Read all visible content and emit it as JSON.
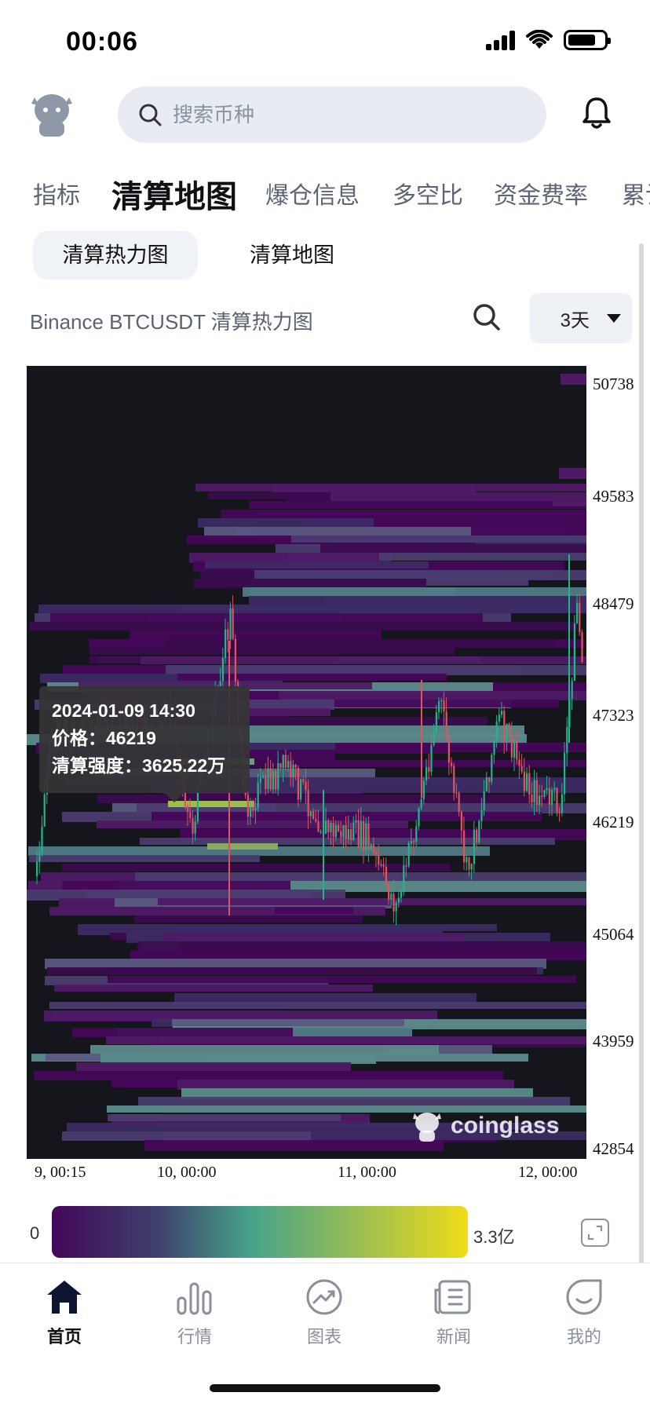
{
  "status_bar": {
    "time": "00:06"
  },
  "header": {
    "search_placeholder": "搜索币种"
  },
  "top_tabs": [
    {
      "label": "指标",
      "active": false
    },
    {
      "label": "清算地图",
      "active": true
    },
    {
      "label": "爆仓信息",
      "active": false
    },
    {
      "label": "多空比",
      "active": false
    },
    {
      "label": "资金费率",
      "active": false
    },
    {
      "label": "累计",
      "active": false
    }
  ],
  "sub_tabs": [
    {
      "label": "清算热力图",
      "active": true
    },
    {
      "label": "清算地图",
      "active": false
    }
  ],
  "chart_header": {
    "title": "Binance BTCUSDT 清算热力图",
    "range_value": "3天"
  },
  "chart_data": {
    "type": "heatmap",
    "y_ticks": [
      "50738",
      "49583",
      "48479",
      "47323",
      "46219",
      "45064",
      "43959",
      "42854"
    ],
    "x_ticks": [
      "9, 00:15",
      "10, 00:00",
      "11, 00:00",
      "12, 00:00"
    ],
    "ylim": [
      42854,
      50738
    ],
    "tooltip": {
      "time": "2024-01-09 14:30",
      "price_label": "价格：",
      "price": "46219",
      "intensity_label": "清算强度：",
      "intensity": "3625.22万"
    },
    "watermark": "coinglass",
    "colors": {
      "background": "#14161c",
      "low": "#44075a",
      "mid": "#47a38a",
      "high": "#f0dc18",
      "candle_up": "#26b38a",
      "candle_down": "#e0545e"
    }
  },
  "color_scale": {
    "min_label": "0",
    "max_label": "3.3亿"
  },
  "bottom_nav": [
    {
      "label": "首页",
      "active": true
    },
    {
      "label": "行情",
      "active": false
    },
    {
      "label": "图表",
      "active": false
    },
    {
      "label": "新闻",
      "active": false
    },
    {
      "label": "我的",
      "active": false
    }
  ]
}
